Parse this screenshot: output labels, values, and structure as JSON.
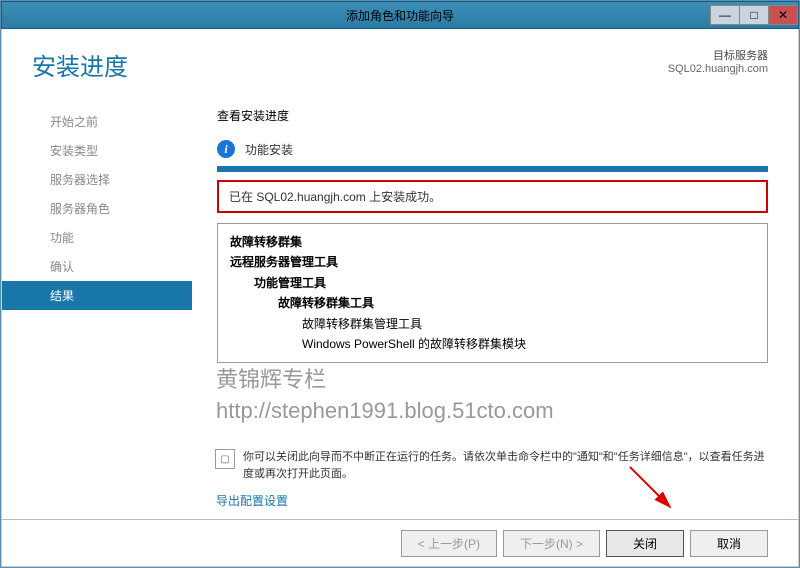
{
  "window": {
    "title": "添加角色和功能向导",
    "min": "—",
    "max": "□",
    "close": "✕"
  },
  "header": {
    "title": "安装进度",
    "target_label": "目标服务器",
    "target_server": "SQL02.huangjh.com"
  },
  "sidebar": {
    "items": [
      {
        "label": "开始之前",
        "active": false
      },
      {
        "label": "安装类型",
        "active": false
      },
      {
        "label": "服务器选择",
        "active": false
      },
      {
        "label": "服务器角色",
        "active": false
      },
      {
        "label": "功能",
        "active": false
      },
      {
        "label": "确认",
        "active": false
      },
      {
        "label": "结果",
        "active": true
      }
    ]
  },
  "content": {
    "view_label": "查看安装进度",
    "status": "功能安装",
    "success_message": "已在 SQL02.huangjh.com 上安装成功。",
    "features": [
      "故障转移群集",
      "远程服务器管理工具",
      "功能管理工具",
      "故障转移群集工具",
      "故障转移群集管理工具",
      "Windows PowerShell 的故障转移群集模块"
    ],
    "note": "你可以关闭此向导而不中断正在运行的任务。请依次单击命令栏中的\"通知\"和\"任务详细信息\"，以查看任务进度或再次打开此页面。",
    "export_link": "导出配置设置"
  },
  "watermark": {
    "line1": "黄锦辉专栏",
    "line2": "http://stephen1991.blog.51cto.com"
  },
  "footer": {
    "prev": "< 上一步(P)",
    "next": "下一步(N) >",
    "close": "关闭",
    "cancel": "取消"
  }
}
